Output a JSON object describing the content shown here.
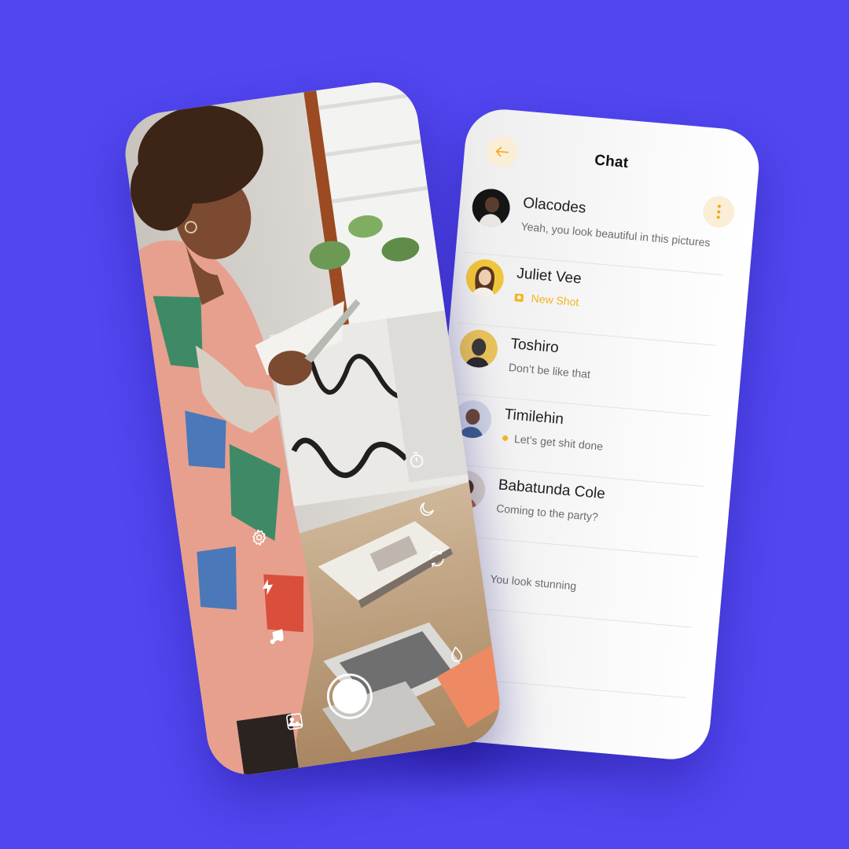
{
  "colors": {
    "background": "#5146ef",
    "accent": "#f3b51f",
    "accent_soft": "#fbeed6"
  },
  "chat": {
    "title": "Chat",
    "back_icon": "arrow-left-icon",
    "menu_icon": "more-vertical-icon",
    "conversations": [
      {
        "name": "Olacodes",
        "message": "Yeah, you look beautiful in this pictures",
        "status": "read"
      },
      {
        "name": "Juliet Vee",
        "message": "New Shot",
        "status": "new-shot"
      },
      {
        "name": "Toshiro",
        "message": "Don’t be like that",
        "status": "read"
      },
      {
        "name": "Timilehin",
        "message": "Let’s get shit done",
        "status": "unread"
      },
      {
        "name": "Babatunda Cole",
        "message": "Coming to the party?",
        "status": "read"
      },
      {
        "name": "",
        "message": "You look stunning",
        "status": "read"
      }
    ]
  },
  "camera": {
    "left_controls": [
      "settings-icon",
      "flash-icon",
      "music-icon"
    ],
    "right_controls": [
      "timer-icon",
      "night-mode-icon",
      "flip-camera-icon",
      "filter-drop-icon"
    ],
    "gallery_icon": "gallery-icon",
    "shutter_icon": "shutter-button"
  }
}
